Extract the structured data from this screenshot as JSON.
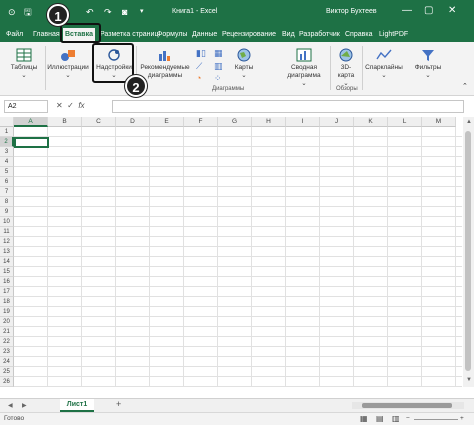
{
  "titlebar": {
    "title": "Книга1 - Excel",
    "user": "Виктор Бухтеев",
    "accent": "#1e7145"
  },
  "tabs": [
    {
      "label": "Файл"
    },
    {
      "label": "Главная"
    },
    {
      "label": "Вставка",
      "active": true
    },
    {
      "label": "Разметка страниц"
    },
    {
      "label": "Формулы"
    },
    {
      "label": "Данные"
    },
    {
      "label": "Рецензирование"
    },
    {
      "label": "Вид"
    },
    {
      "label": "Разработчик"
    },
    {
      "label": "Справка"
    },
    {
      "label": "LightPDF"
    }
  ],
  "ribbon": {
    "tables": "Таблицы",
    "illustrations": "Иллюстрации",
    "addins": "Надстройки",
    "recommended_charts": "Рекомендуемые диаграммы",
    "maps": "Карты",
    "pivot_chart": "Сводная диаграмма",
    "map3d": "3D-карта",
    "sparklines": "Спарклайны",
    "filters": "Фильтры",
    "group_charts": "Диаграммы",
    "group_tours": "Обзоры"
  },
  "formula_bar": {
    "name_box": "A2",
    "formula": ""
  },
  "grid": {
    "columns": [
      "A",
      "B",
      "C",
      "D",
      "E",
      "F",
      "G",
      "H",
      "I",
      "J",
      "K",
      "L",
      "M"
    ],
    "rows": [
      "1",
      "2",
      "3",
      "4",
      "5",
      "6",
      "7",
      "8",
      "9",
      "10",
      "11",
      "12",
      "13",
      "14",
      "15",
      "16",
      "17",
      "18",
      "19",
      "20",
      "21",
      "22",
      "23",
      "24",
      "25",
      "26"
    ],
    "active_cell": "A2"
  },
  "sheets": {
    "tabs": [
      "Лист1"
    ],
    "add_label": "+"
  },
  "status": {
    "text": "Готово"
  },
  "callouts": {
    "badge1": "1",
    "badge2": "2"
  },
  "icons": {
    "save": "save-icon",
    "undo": "undo-icon",
    "redo": "redo-icon",
    "minimize": "minimize-icon",
    "maximize": "maximize-icon",
    "close": "close-icon"
  }
}
